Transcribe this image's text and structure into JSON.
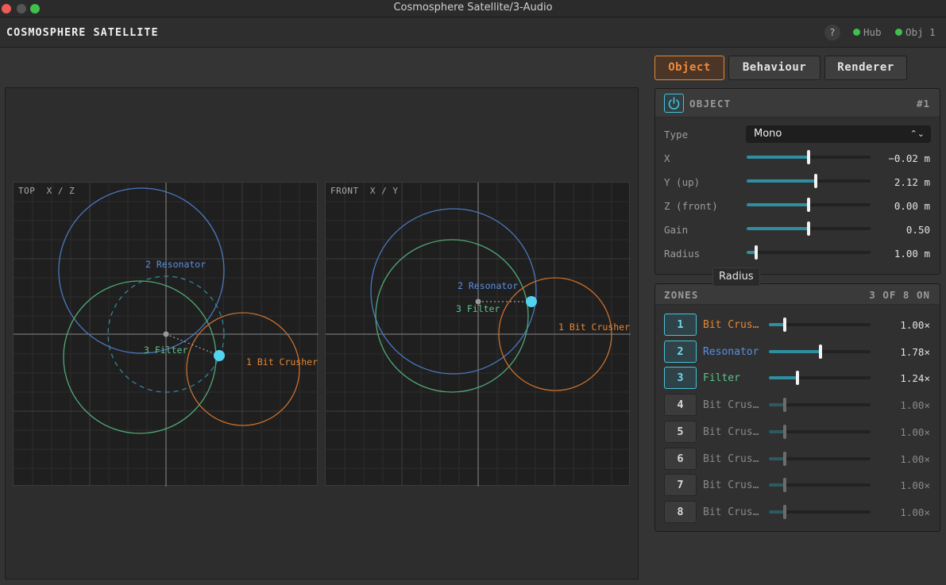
{
  "window": {
    "title": "Cosmosphere Satellite/3-Audio"
  },
  "header": {
    "app_name": "COSMOSPHERE SATELLITE",
    "help_label": "?",
    "status": [
      {
        "label": "Hub",
        "color": "#3fc04f"
      },
      {
        "label": "Obj 1",
        "color": "#3fc04f"
      }
    ]
  },
  "tabs": [
    {
      "label": "Object",
      "active": true
    },
    {
      "label": "Behaviour",
      "active": false
    },
    {
      "label": "Renderer",
      "active": false
    }
  ],
  "views": {
    "top": {
      "title": "TOP  X / Z"
    },
    "front": {
      "title": "FRONT  X / Y"
    },
    "zone_labels": {
      "bit_crusher": "1 Bit Crusher",
      "resonator": "2 Resonator",
      "filter": "3 Filter"
    },
    "colors": {
      "bit_crusher": "#c8702e",
      "resonator": "#4a78c0",
      "filter": "#4fa877",
      "object": "#52d4f0"
    }
  },
  "object_panel": {
    "title": "OBJECT",
    "id_label": "#1",
    "type": {
      "label": "Type",
      "value": "Mono"
    },
    "params": [
      {
        "label": "X",
        "value": "−0.02 m",
        "level": 0.5
      },
      {
        "label": "Y (up)",
        "value": "2.12 m",
        "level": 0.56
      },
      {
        "label": "Z (front)",
        "value": "0.00 m",
        "level": 0.5
      },
      {
        "label": "Gain",
        "value": "0.50",
        "level": 0.5
      },
      {
        "label": "Radius",
        "value": "1.00 m",
        "level": 0.08
      }
    ],
    "tooltip": "Radius"
  },
  "zones_panel": {
    "title": "ZONES",
    "summary": "3 OF 8 ON",
    "zones": [
      {
        "num": "1",
        "name": "Bit Crus…",
        "value": "1.00×",
        "on": true,
        "color": "#e58634",
        "level": 0.16
      },
      {
        "num": "2",
        "name": "Resonator",
        "value": "1.78×",
        "on": true,
        "color": "#5b8ee0",
        "level": 0.51
      },
      {
        "num": "3",
        "name": "Filter",
        "value": "1.24×",
        "on": true,
        "color": "#5cc28a",
        "level": 0.28
      },
      {
        "num": "4",
        "name": "Bit Crus…",
        "value": "1.00×",
        "on": false,
        "color": "#888888",
        "level": 0.16
      },
      {
        "num": "5",
        "name": "Bit Crus…",
        "value": "1.00×",
        "on": false,
        "color": "#888888",
        "level": 0.16
      },
      {
        "num": "6",
        "name": "Bit Crus…",
        "value": "1.00×",
        "on": false,
        "color": "#888888",
        "level": 0.16
      },
      {
        "num": "7",
        "name": "Bit Crus…",
        "value": "1.00×",
        "on": false,
        "color": "#888888",
        "level": 0.16
      },
      {
        "num": "8",
        "name": "Bit Crus…",
        "value": "1.00×",
        "on": false,
        "color": "#888888",
        "level": 0.16
      }
    ]
  }
}
